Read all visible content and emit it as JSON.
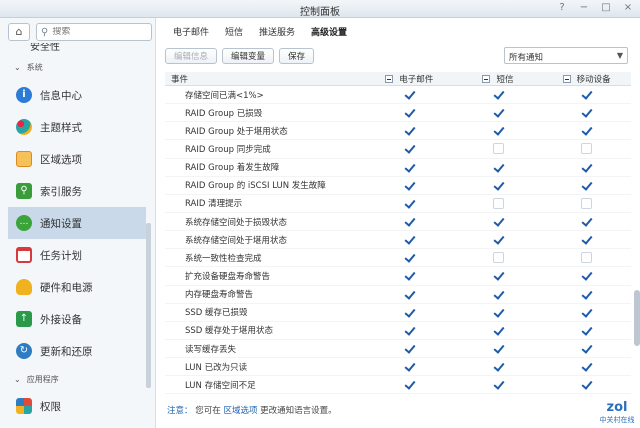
{
  "window": {
    "title": "控制面板",
    "buttons": [
      "?",
      "−",
      "□",
      "×"
    ]
  },
  "sidebar": {
    "search_placeholder": "搜索",
    "cut_item": "安全性",
    "groups": [
      {
        "label": "系统"
      },
      {
        "label": "应用程序"
      }
    ],
    "items": [
      {
        "label": "信息中心",
        "icon": "info-icon",
        "color": "#2c7bd6"
      },
      {
        "label": "主题样式",
        "icon": "palette-icon",
        "color": "#2aa3a3"
      },
      {
        "label": "区域选项",
        "icon": "region-icon",
        "color": "#e08a1e"
      },
      {
        "label": "索引服务",
        "icon": "index-search-icon",
        "color": "#3a9c3a"
      },
      {
        "label": "通知设置",
        "icon": "chat-bubble-icon",
        "color": "#3aa33a",
        "active": true
      },
      {
        "label": "任务计划",
        "icon": "calendar-icon",
        "color": "#d63b3b"
      },
      {
        "label": "硬件和电源",
        "icon": "bulb-icon",
        "color": "#f0b21e"
      },
      {
        "label": "外接设备",
        "icon": "usb-upload-icon",
        "color": "#2a9a4a"
      },
      {
        "label": "更新和还原",
        "icon": "update-icon",
        "color": "#2e7dc4"
      },
      {
        "label": "权限",
        "icon": "grid-icon",
        "color": "#e04a3a"
      }
    ]
  },
  "tabs": [
    {
      "label": "电子邮件",
      "active": false
    },
    {
      "label": "短信",
      "active": false
    },
    {
      "label": "推送服务",
      "active": false
    },
    {
      "label": "高级设置",
      "active": true
    }
  ],
  "toolbar": {
    "edit_info": "编辑信息",
    "edit_vars": "编辑变量",
    "save": "保存"
  },
  "filter": {
    "value": "所有通知"
  },
  "table": {
    "columns": [
      "事件",
      "电子邮件",
      "短信",
      "移动设备"
    ],
    "rows": [
      {
        "event": "存储空间已满<1%>",
        "email": true,
        "sms": true,
        "mobile": true
      },
      {
        "event": "RAID Group 已损毁",
        "email": true,
        "sms": true,
        "mobile": true
      },
      {
        "event": "RAID Group 处于堪用状态",
        "email": true,
        "sms": true,
        "mobile": true
      },
      {
        "event": "RAID Group 同步完成",
        "email": true,
        "sms": false,
        "mobile": false
      },
      {
        "event": "RAID Group 着发生故障",
        "email": true,
        "sms": true,
        "mobile": true
      },
      {
        "event": "RAID Group 的 iSCSI LUN 发生故障",
        "email": true,
        "sms": true,
        "mobile": true
      },
      {
        "event": "RAID 清理提示",
        "email": true,
        "sms": false,
        "mobile": false
      },
      {
        "event": "系统存储空间处于损毁状态",
        "email": true,
        "sms": true,
        "mobile": true
      },
      {
        "event": "系统存储空间处于堪用状态",
        "email": true,
        "sms": true,
        "mobile": true
      },
      {
        "event": "系统一致性检查完成",
        "email": true,
        "sms": false,
        "mobile": false
      },
      {
        "event": "扩充设备硬盘寿命警告",
        "email": true,
        "sms": true,
        "mobile": true
      },
      {
        "event": "内存硬盘寿命警告",
        "email": true,
        "sms": true,
        "mobile": true
      },
      {
        "event": "SSD 缓存已损毁",
        "email": true,
        "sms": true,
        "mobile": true
      },
      {
        "event": "SSD 缓存处于堪用状态",
        "email": true,
        "sms": true,
        "mobile": true
      },
      {
        "event": "读写缓存丢失",
        "email": true,
        "sms": true,
        "mobile": true
      },
      {
        "event": "LUN 已改为只读",
        "email": true,
        "sms": true,
        "mobile": true
      },
      {
        "event": "LUN 存储空间不足",
        "email": true,
        "sms": true,
        "mobile": true
      }
    ]
  },
  "hint": {
    "label": "注意：",
    "before": "您可在",
    "link": "区域选项",
    "after": "更改通知语言设置。"
  },
  "watermark": {
    "brand": "zol",
    "text": "中关村在线"
  }
}
